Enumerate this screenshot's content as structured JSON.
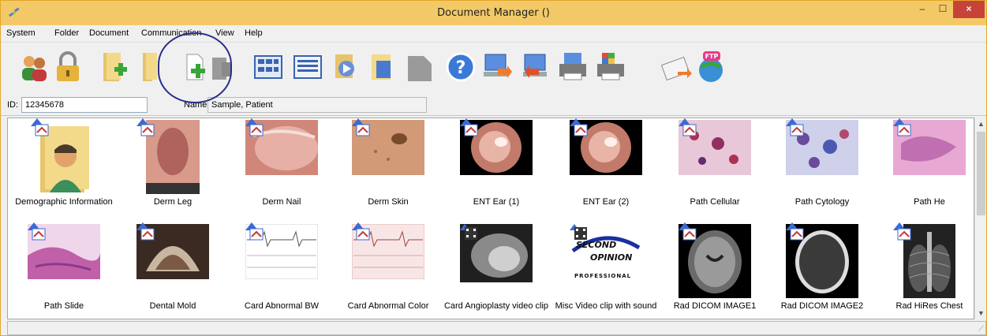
{
  "window": {
    "title": "Document Manager ()"
  },
  "menu": [
    "System",
    "Folder",
    "Document",
    "Communication",
    "View",
    "Help"
  ],
  "toolbar": {
    "icons": [
      "users-icon",
      "lock-icon",
      "add-folder-icon",
      "folder-icon",
      "add-document-icon",
      "document-gray-icon",
      "thumbnail-view-icon",
      "list-view-icon",
      "import-icon",
      "export-icon",
      "gray-shape-icon",
      "help-icon",
      "send-icon",
      "receive-icon",
      "print-icon",
      "print-color-icon",
      "email-icon",
      "ftp-icon"
    ]
  },
  "patient": {
    "id_label": "ID:",
    "id_value": "12345678",
    "name_label": "Name:",
    "name_value": "Sample, Patient"
  },
  "documents": [
    {
      "caption": "Demographic Information",
      "kind": "folder-person"
    },
    {
      "caption": "Derm Leg",
      "kind": "derm-leg"
    },
    {
      "caption": "Derm Nail",
      "kind": "derm-nail"
    },
    {
      "caption": "Derm Skin",
      "kind": "derm-skin"
    },
    {
      "caption": "ENT Ear (1)",
      "kind": "ear"
    },
    {
      "caption": "ENT Ear (2)",
      "kind": "ear"
    },
    {
      "caption": "Path Cellular",
      "kind": "path-red"
    },
    {
      "caption": "Path Cytology",
      "kind": "path-blue"
    },
    {
      "caption": "Path He",
      "kind": "path-pink"
    },
    {
      "caption": "Path Slide",
      "kind": "path-slide"
    },
    {
      "caption": "Dental Mold",
      "kind": "dental"
    },
    {
      "caption": "Card Abnormal BW",
      "kind": "ecg"
    },
    {
      "caption": "Card Abnormal Color",
      "kind": "ecg-color"
    },
    {
      "caption": "Card Angioplasty video clip",
      "kind": "angio"
    },
    {
      "caption": "Misc Video clip with sound",
      "kind": "logo"
    },
    {
      "caption": "Rad DICOM IMAGE1",
      "kind": "mri"
    },
    {
      "caption": "Rad DICOM IMAGE2",
      "kind": "ct"
    },
    {
      "caption": "Rad HiRes Chest",
      "kind": "xray"
    }
  ],
  "logo_text": [
    "SECOND",
    "OPINION",
    "PROFESSIONAL"
  ],
  "colors": {
    "titlebar": "#f3c967",
    "close": "#c7433a",
    "highlight": "#2a2d8a"
  }
}
